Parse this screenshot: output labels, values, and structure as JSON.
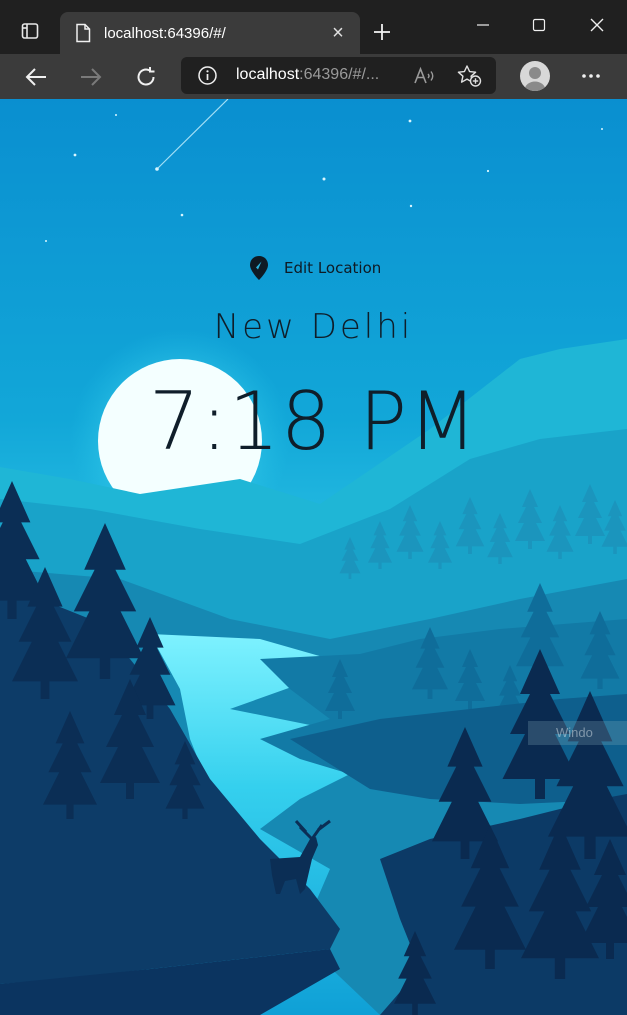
{
  "browser": {
    "tab_title": "localhost:64396/#/",
    "tab_close_glyph": "×",
    "address": {
      "host": "localhost",
      "rest": ":64396/#/..."
    },
    "icons": [
      "tab-actions-icon",
      "page-icon",
      "plus-icon",
      "minimize-icon",
      "maximize-icon",
      "close-icon",
      "back-arrow-icon",
      "forward-arrow-icon",
      "refresh-icon",
      "info-icon",
      "read-aloud-icon",
      "favorite-add-icon",
      "profile-avatar",
      "more-dots-icon"
    ]
  },
  "page": {
    "edit_location_label": "Edit Location",
    "city": "New Delhi",
    "time": "7:18 PM",
    "watermark": "Windo"
  },
  "colors": {
    "sky_top": "#0a95d1",
    "sky_bottom": "#35c8e6",
    "text_dark": "#0f1e2a",
    "tree_dark": "#0b2e55"
  }
}
